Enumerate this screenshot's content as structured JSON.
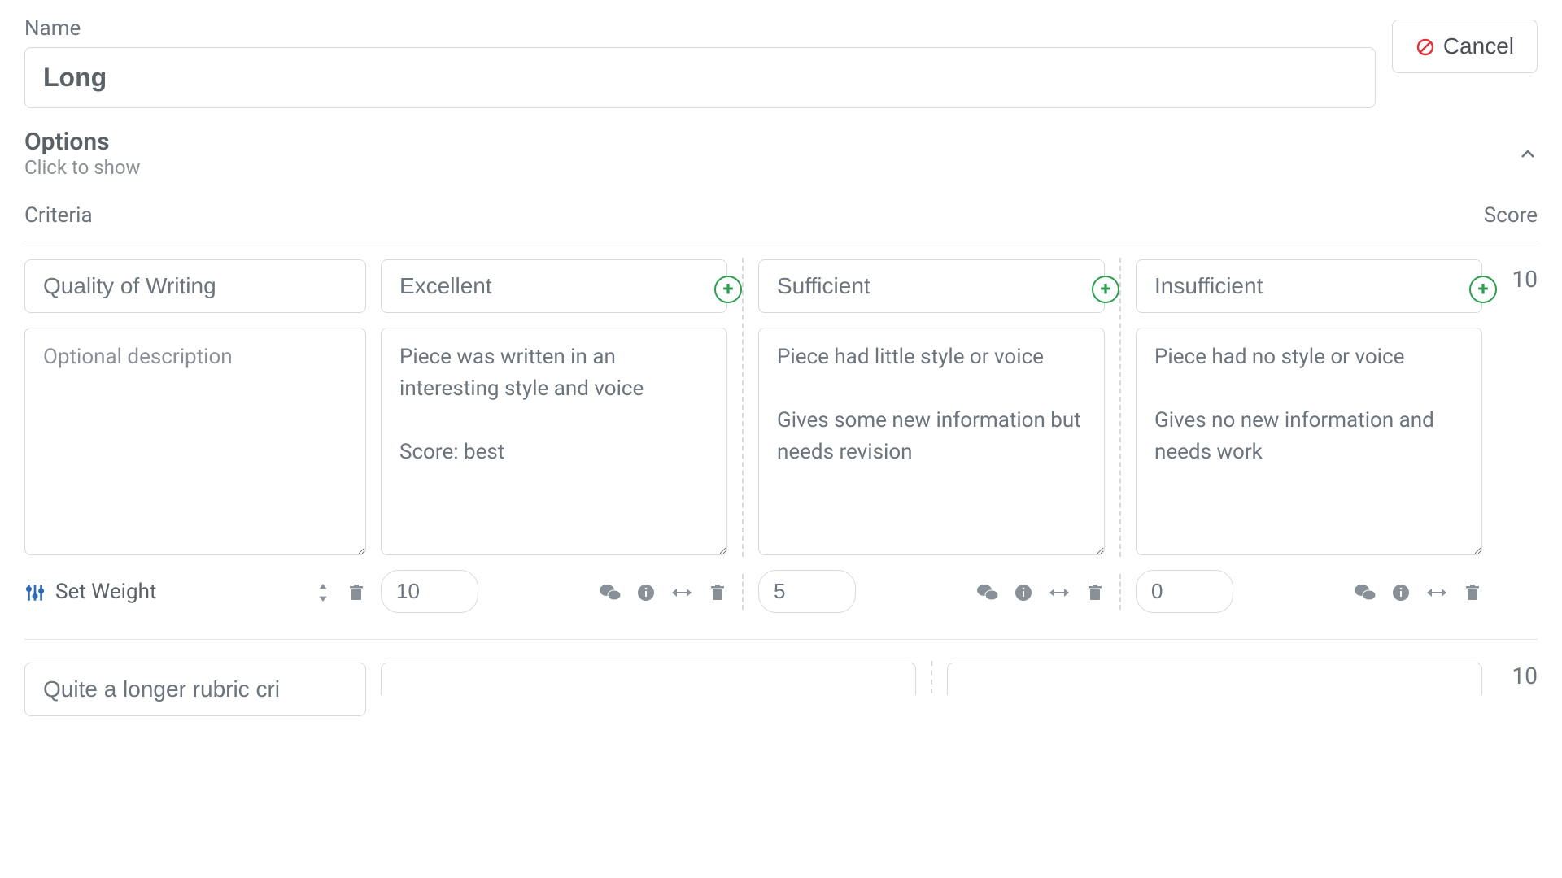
{
  "name": {
    "label": "Name",
    "value": "Long"
  },
  "cancel_label": "Cancel",
  "options": {
    "title": "Options",
    "subtitle": "Click to show"
  },
  "headers": {
    "criteria": "Criteria",
    "score": "Score"
  },
  "set_weight_label": "Set Weight",
  "criterion1": {
    "title": "Quality of Writing",
    "desc_placeholder": "Optional description",
    "score": "10",
    "levels": [
      {
        "title": "Excellent",
        "desc": "Piece was written in an interesting style and voice\n\nScore: best",
        "points": "10"
      },
      {
        "title": "Sufficient",
        "desc": "Piece had little style or voice\n\nGives some new information but needs revision",
        "points": "5"
      },
      {
        "title": "Insufficient",
        "desc": "Piece had no style or voice\n\nGives no new information and needs work",
        "points": "0"
      }
    ]
  },
  "criterion2": {
    "title": "Quite a longer rubric cri",
    "score": "10"
  }
}
